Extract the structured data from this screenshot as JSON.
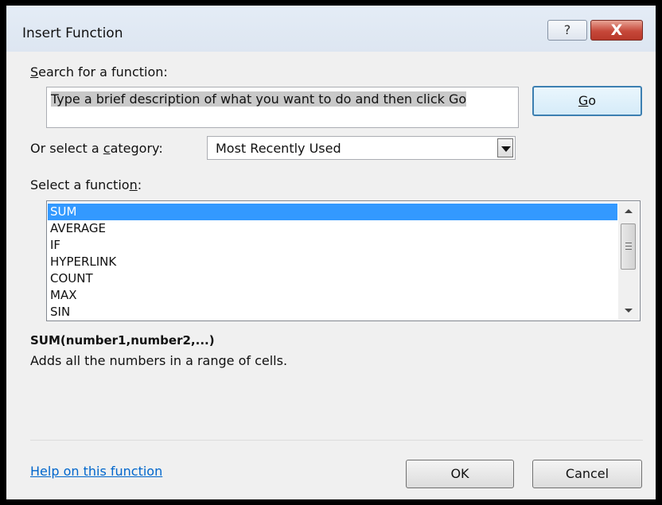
{
  "window": {
    "title": "Insert Function",
    "help_glyph": "?",
    "close_glyph": "X"
  },
  "search": {
    "label_prefix": "",
    "label_underline": "S",
    "label_rest": "earch for a function:",
    "value": "Type a brief description of what you want to do and then click Go",
    "go_underline": "G",
    "go_rest": "o"
  },
  "category": {
    "label_prefix": "Or select a ",
    "label_underline": "c",
    "label_rest": "ategory:",
    "selected": "Most Recently Used"
  },
  "functions": {
    "label_prefix": "Select a functio",
    "label_underline": "n",
    "label_rest": ":",
    "items": [
      "SUM",
      "AVERAGE",
      "IF",
      "HYPERLINK",
      "COUNT",
      "MAX",
      "SIN"
    ],
    "selected_index": 0
  },
  "detail": {
    "signature": "SUM(number1,number2,...)",
    "description": "Adds all the numbers in a range of cells."
  },
  "footer": {
    "help_link": "Help on this function",
    "ok_label": "OK",
    "cancel_label": "Cancel"
  },
  "icons": {
    "select_arrow": "chevron-down-icon",
    "scroll_up": "scroll-up-arrow-icon",
    "scroll_down": "scroll-down-arrow-icon"
  },
  "colors": {
    "selection": "#3399ff",
    "close_button": "#c6483a",
    "link": "#0066cc"
  }
}
